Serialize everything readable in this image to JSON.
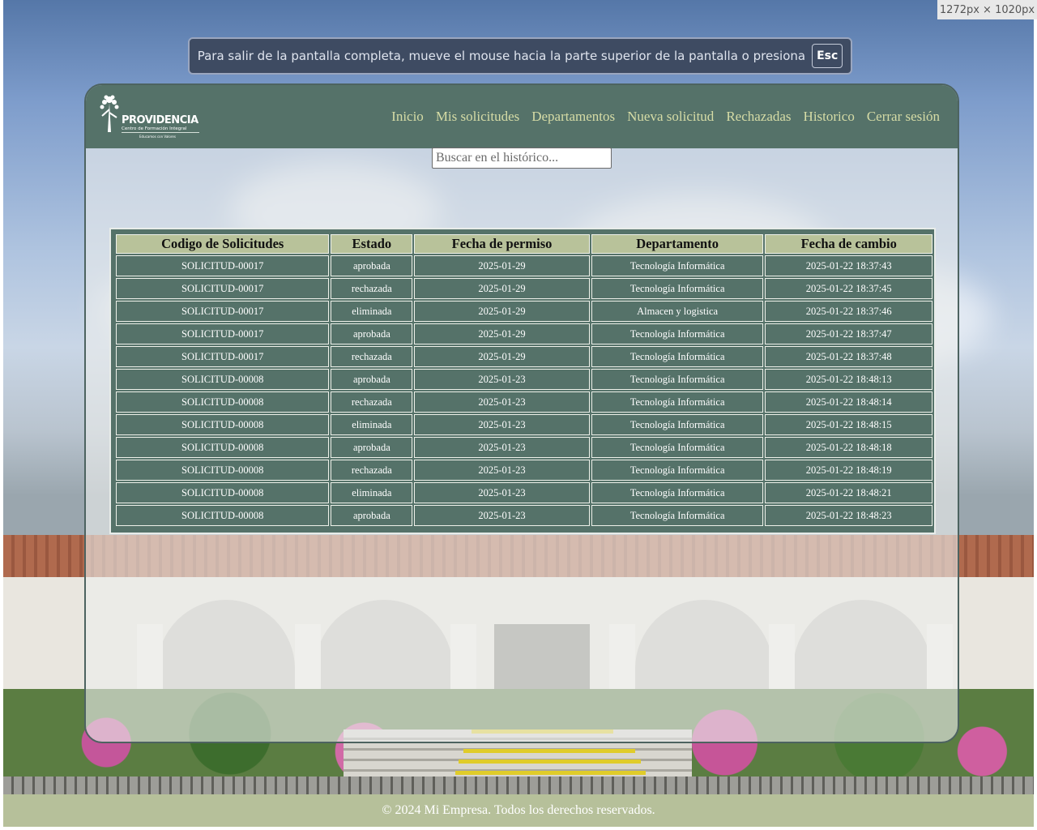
{
  "fullscreen_notice": {
    "text": "Para salir de la pantalla completa, mueve el mouse hacia la parte superior de la pantalla o presiona",
    "key": "Esc"
  },
  "dimension_badge": "1272px × 1020px",
  "brand": {
    "name": "PROVIDENCIA",
    "subtitle": "Centro de Formación Integral",
    "motto": "Educamos con Valores"
  },
  "nav": {
    "items": [
      "Inicio",
      "Mis solicitudes",
      "Departamentos",
      "Nueva solicitud",
      "Rechazadas",
      "Historico",
      "Cerrar sesión"
    ]
  },
  "search": {
    "placeholder": "Buscar en el histórico..."
  },
  "table": {
    "headers": [
      "Codigo de Solicitudes",
      "Estado",
      "Fecha de permiso",
      "Departamento",
      "Fecha de cambio"
    ],
    "rows": [
      [
        "SOLICITUD-00017",
        "aprobada",
        "2025-01-29",
        "Tecnología Informática",
        "2025-01-22 18:37:43"
      ],
      [
        "SOLICITUD-00017",
        "rechazada",
        "2025-01-29",
        "Tecnología Informática",
        "2025-01-22 18:37:45"
      ],
      [
        "SOLICITUD-00017",
        "eliminada",
        "2025-01-29",
        "Almacen y logistica",
        "2025-01-22 18:37:46"
      ],
      [
        "SOLICITUD-00017",
        "aprobada",
        "2025-01-29",
        "Tecnología Informática",
        "2025-01-22 18:37:47"
      ],
      [
        "SOLICITUD-00017",
        "rechazada",
        "2025-01-29",
        "Tecnología Informática",
        "2025-01-22 18:37:48"
      ],
      [
        "SOLICITUD-00008",
        "aprobada",
        "2025-01-23",
        "Tecnología Informática",
        "2025-01-22 18:48:13"
      ],
      [
        "SOLICITUD-00008",
        "rechazada",
        "2025-01-23",
        "Tecnología Informática",
        "2025-01-22 18:48:14"
      ],
      [
        "SOLICITUD-00008",
        "eliminada",
        "2025-01-23",
        "Tecnología Informática",
        "2025-01-22 18:48:15"
      ],
      [
        "SOLICITUD-00008",
        "aprobada",
        "2025-01-23",
        "Tecnología Informática",
        "2025-01-22 18:48:18"
      ],
      [
        "SOLICITUD-00008",
        "rechazada",
        "2025-01-23",
        "Tecnología Informática",
        "2025-01-22 18:48:19"
      ],
      [
        "SOLICITUD-00008",
        "eliminada",
        "2025-01-23",
        "Tecnología Informática",
        "2025-01-22 18:48:21"
      ],
      [
        "SOLICITUD-00008",
        "aprobada",
        "2025-01-23",
        "Tecnología Informática",
        "2025-01-22 18:48:23"
      ]
    ]
  },
  "footer": {
    "text": "© 2024 Mi Empresa. Todos los derechos reservados."
  },
  "colors": {
    "nav": "#557269",
    "header_cells": "#b8c29a",
    "footer": "#b6c09a",
    "nav_links": "#d6dca6"
  }
}
